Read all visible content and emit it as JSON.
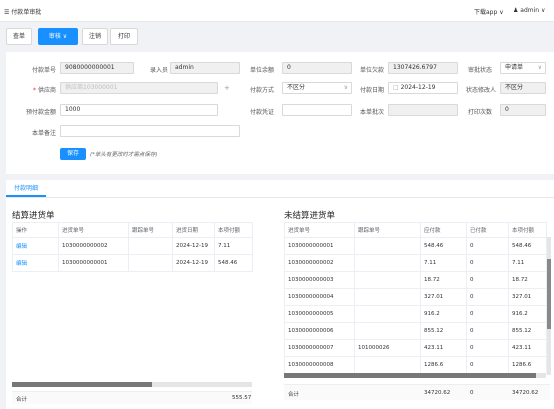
{
  "header": {
    "title": "☰ 付款单审批",
    "download": "下载app ∨",
    "user": "admin ∨"
  },
  "toolbar": {
    "list_label": "查单",
    "audit_label": "审核 ∨",
    "cancel_label": "注销",
    "print_label": "打印"
  },
  "form": {
    "order_no_label": "付款单号",
    "order_no": "9080000000001",
    "entry_label": "录入员",
    "entry": "admin",
    "balance_label": "单位余额",
    "balance": "0",
    "debt_label": "单位欠款",
    "debt": "1307426.6797",
    "status_label": "审批状态",
    "status": "申请单",
    "supplier_label": "供应商",
    "supplier_placeholder": "供应商103000001",
    "pay_method_label": "付款方式",
    "pay_method": "不区分",
    "pay_date_label": "付款日期",
    "pay_date": "2024-12-19",
    "modifier_label": "状态修改人",
    "modifier": "不区分",
    "prepay_label": "预付款金额",
    "prepay": "1000",
    "voucher_label": "付款凭证",
    "batch_label": "本单批次",
    "print_count_label": "打印次数",
    "print_count": "0",
    "remark_label": "本单备注",
    "save_label": "保存",
    "hint": "(*单头有更改时才需点保存)"
  },
  "detail": {
    "tab_label": "付款明细",
    "left": {
      "title": "结算进货单",
      "columns": [
        "操作",
        "进货单号",
        "跟踪单号",
        "进货日期",
        "本项付额"
      ],
      "rows": [
        [
          "编辑",
          "1030000000002",
          "",
          "2024-12-19",
          "7.11"
        ],
        [
          "编辑",
          "1030000000001",
          "",
          "2024-12-19",
          "548.46"
        ]
      ],
      "sum_label": "合计",
      "sum_value": "555.57"
    },
    "right": {
      "title": "未结算进货单",
      "columns": [
        "进货单号",
        "跟踪单号",
        "应付款",
        "已付款",
        "本项付额"
      ],
      "rows": [
        [
          "1030000000001",
          "",
          "548.46",
          "0",
          "548.46"
        ],
        [
          "1030000000002",
          "",
          "7.11",
          "0",
          "7.11"
        ],
        [
          "1030000000003",
          "",
          "18.72",
          "0",
          "18.72"
        ],
        [
          "1030000000004",
          "",
          "327.01",
          "0",
          "327.01"
        ],
        [
          "1030000000005",
          "",
          "916.2",
          "0",
          "916.2"
        ],
        [
          "1030000000006",
          "",
          "855.12",
          "0",
          "855.12"
        ],
        [
          "1030000000007",
          "101000026",
          "423.11",
          "0",
          "423.11"
        ],
        [
          "1030000000008",
          "",
          "1286.6",
          "0",
          "1286.6"
        ]
      ],
      "sum_label": "合计",
      "sum_due": "34720.62",
      "sum_paid": "0",
      "sum_value": "34720.62"
    }
  }
}
